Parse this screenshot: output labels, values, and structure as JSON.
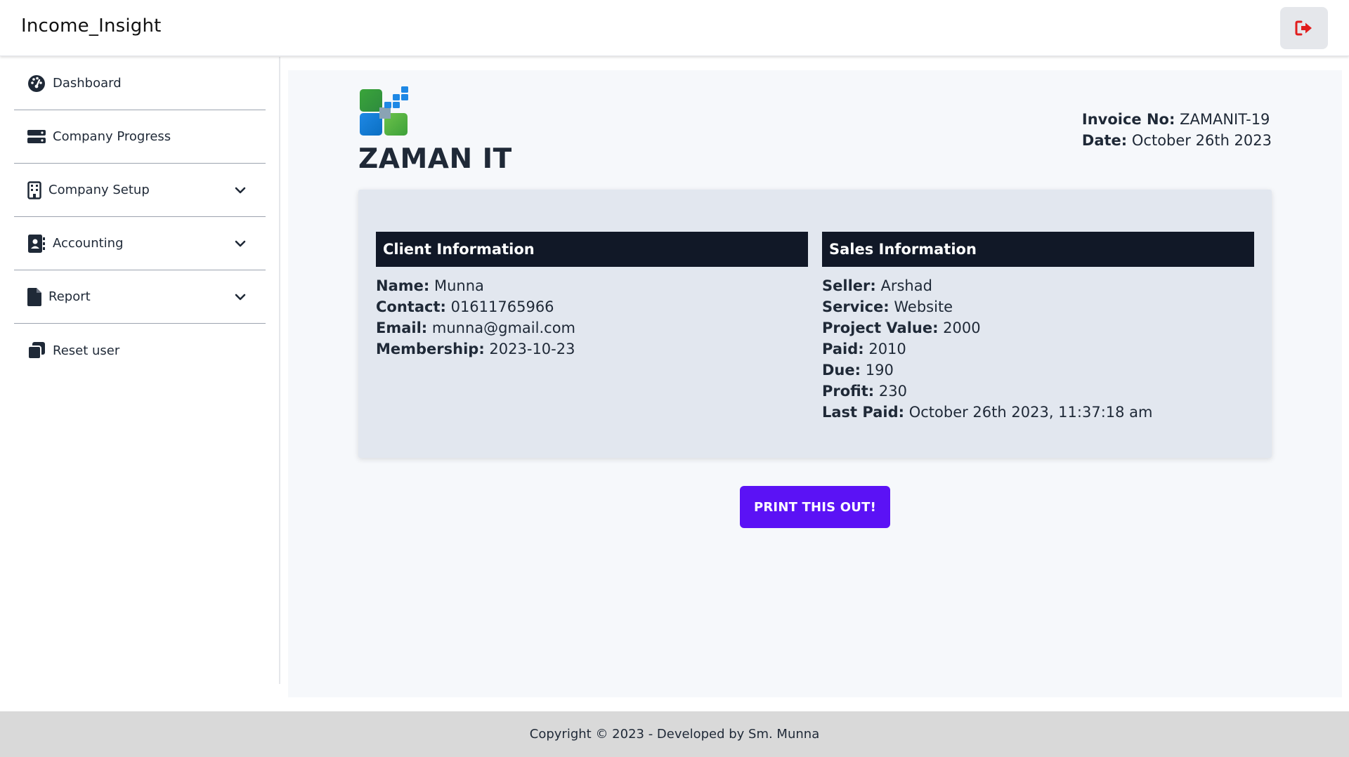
{
  "app": {
    "title": "Income_Insight"
  },
  "header": {
    "logout_icon": "sign-out-icon",
    "logout_color": "#e11d1d"
  },
  "sidebar": {
    "items": [
      {
        "label": "Dashboard",
        "icon": "gauge-icon",
        "expandable": false
      },
      {
        "label": "Company Progress",
        "icon": "server-icon",
        "expandable": false
      },
      {
        "label": "Company Setup",
        "icon": "building-icon",
        "expandable": true
      },
      {
        "label": "Accounting",
        "icon": "address-book-icon",
        "expandable": true
      },
      {
        "label": "Report",
        "icon": "file-icon",
        "expandable": true
      },
      {
        "label": "Reset user",
        "icon": "copy-icon",
        "expandable": false
      }
    ]
  },
  "invoice": {
    "company_name": "ZAMAN IT",
    "invoice_no_label": "Invoice No:",
    "invoice_no": "ZAMANIT-19",
    "date_label": "Date:",
    "date": "October 26th 2023",
    "client": {
      "heading": "Client Information",
      "fields": [
        {
          "label": "Name:",
          "value": "Munna"
        },
        {
          "label": "Contact:",
          "value": "01611765966"
        },
        {
          "label": "Email:",
          "value": "munna@gmail.com"
        },
        {
          "label": "Membership:",
          "value": "2023-10-23"
        }
      ]
    },
    "sales": {
      "heading": "Sales Information",
      "fields": [
        {
          "label": "Seller:",
          "value": "Arshad"
        },
        {
          "label": "Service:",
          "value": "Website"
        },
        {
          "label": "Project Value:",
          "value": "2000"
        },
        {
          "label": "Paid:",
          "value": "2010"
        },
        {
          "label": "Due:",
          "value": "190"
        },
        {
          "label": "Profit:",
          "value": "230"
        },
        {
          "label": "Last Paid:",
          "value": "October 26th 2023, 11:37:18 am"
        }
      ]
    },
    "print_label": "PRINT THIS OUT!"
  },
  "footer": {
    "text": "Copyright © 2023 - Developed by Sm. Munna"
  },
  "colors": {
    "accent": "#5b12f5",
    "header_bar": "#111827",
    "card_bg": "#e2e7ef"
  }
}
